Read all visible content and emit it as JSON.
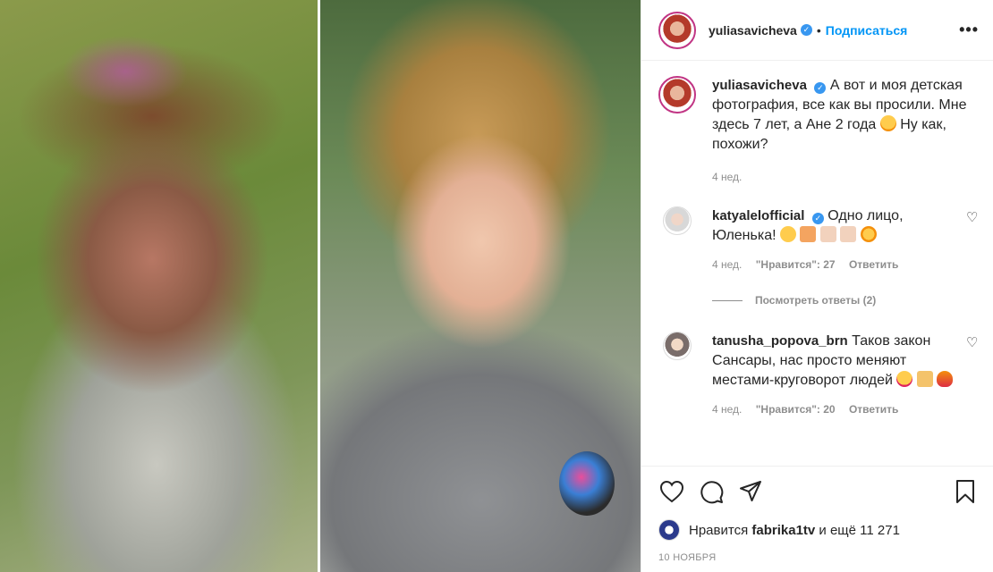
{
  "post": {
    "author": "yuliasavicheva",
    "follow_label": "Подписаться",
    "dot": "•",
    "more": "•••"
  },
  "caption": {
    "author": "yuliasavicheva",
    "text": "А вот и моя детская фотография, все как вы просили. Мне здесь 7 лет, а Ане 2 года",
    "text_tail": "Ну как, похожи?",
    "time": "4 нед."
  },
  "comments": [
    {
      "author": "katyalelofficial",
      "verified": true,
      "text": "Одно лицо, Юленька!",
      "time": "4 нед.",
      "likes": "\"Нравится\": 27",
      "reply": "Ответить",
      "view_replies": "Посмотреть ответы (2)"
    },
    {
      "author": "tanusha_popova_brn",
      "verified": false,
      "text": "Таков закон Сансары, нас просто меняют местами-круговорот людей",
      "time": "4 нед.",
      "likes": "\"Нравится\": 20",
      "reply": "Ответить"
    }
  ],
  "likes": {
    "prefix": "Нравится",
    "user": "fabrika1tv",
    "suffix": "и ещё 11 271"
  },
  "date": "10 НОЯБРЯ",
  "colors": {
    "accent": "#0095f6",
    "muted": "#8e8e8e",
    "verified": "#3897f0"
  }
}
